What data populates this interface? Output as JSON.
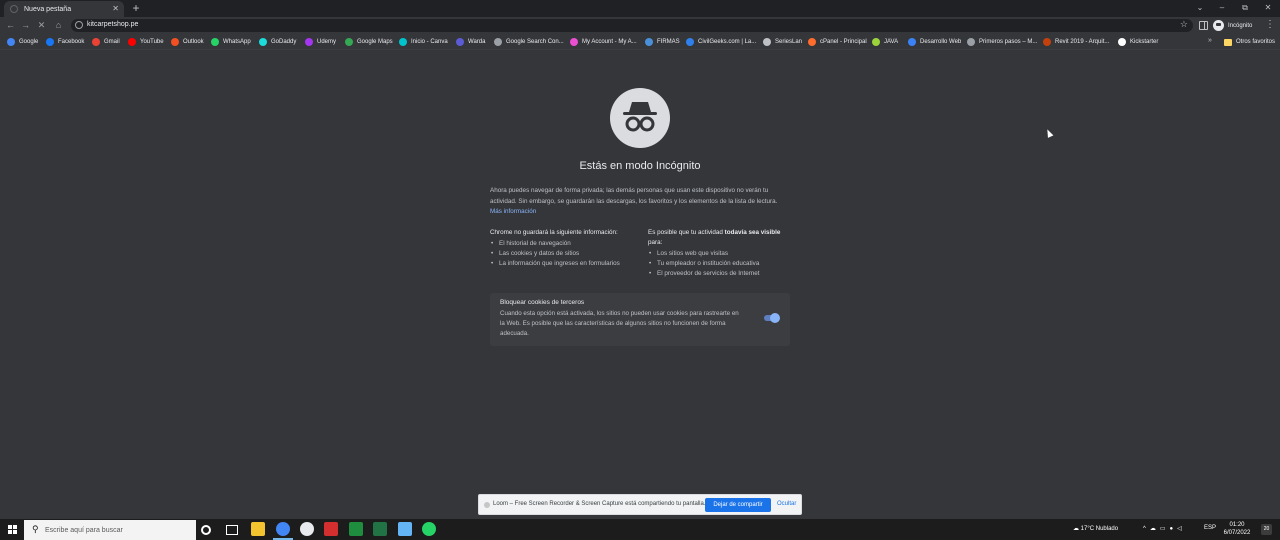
{
  "colors": {
    "page_bg": "#35363a",
    "tabstrip_bg": "#202124",
    "link": "#8ab4f8",
    "button_primary": "#1a73e8"
  },
  "tab": {
    "title": "Nueva pestaña",
    "close_icon": "close-icon",
    "new_tab_label": "+"
  },
  "window": {
    "minimize": "–",
    "restore": "⧉",
    "close": "✕",
    "tab_search": "⌄"
  },
  "toolbar": {
    "back": "←",
    "forward": "→",
    "reload": "✕",
    "home": "⌂",
    "url": "kitcarpetshop.pe",
    "star": "☆",
    "profile_label": "Incógnito",
    "menu": "⋮"
  },
  "bookmarks": {
    "items": [
      {
        "label": "Google",
        "icon": "google-icon",
        "color": "#4285f4"
      },
      {
        "label": "Facebook",
        "icon": "facebook-icon",
        "color": "#1877f2"
      },
      {
        "label": "Gmail",
        "icon": "gmail-icon",
        "color": "#ea4335"
      },
      {
        "label": "YouTube",
        "icon": "youtube-icon",
        "color": "#ff0000"
      },
      {
        "label": "Outlook",
        "icon": "outlook-icon",
        "color": "#f25022"
      },
      {
        "label": "WhatsApp",
        "icon": "whatsapp-icon",
        "color": "#25d366"
      },
      {
        "label": "GoDaddy",
        "icon": "godaddy-icon",
        "color": "#1bdbdb"
      },
      {
        "label": "Udemy",
        "icon": "udemy-icon",
        "color": "#a435f0"
      },
      {
        "label": "Google Maps",
        "icon": "maps-icon",
        "color": "#34a853"
      },
      {
        "label": "Inicio - Canva",
        "icon": "canva-icon",
        "color": "#00c4cc"
      },
      {
        "label": "Warda",
        "icon": "warda-icon",
        "color": "#5b5bd6"
      },
      {
        "label": "Google Search Con...",
        "icon": "search-console-icon",
        "color": "#9aa0a6"
      },
      {
        "label": "My Account - My A...",
        "icon": "account-icon",
        "color": "#e94fd0"
      },
      {
        "label": "FIRMAS",
        "icon": "firmas-icon",
        "color": "#4a90d9"
      },
      {
        "label": "CivilGeeks.com | La...",
        "icon": "civilgeeks-icon",
        "color": "#2f80ed"
      },
      {
        "label": "SeriesLan",
        "icon": "serieslan-icon",
        "color": "#bdc1c6"
      },
      {
        "label": "cPanel - Principal",
        "icon": "cpanel-icon",
        "color": "#ff6c2c"
      },
      {
        "label": "JAVA",
        "icon": "java-icon",
        "color": "#9bd33b"
      },
      {
        "label": "Desarrollo Web",
        "icon": "web-icon",
        "color": "#3b82f6"
      },
      {
        "label": "Primeros pasos – M...",
        "icon": "globe-icon",
        "color": "#9aa0a6"
      },
      {
        "label": "Revit 2019 - Arquit...",
        "icon": "revit-icon",
        "color": "#c2410c"
      },
      {
        "label": "Kickstarter",
        "icon": "kickstarter-icon",
        "color": "#ffffff"
      }
    ],
    "more": "»",
    "other_folder": "Otros favoritos"
  },
  "incognito": {
    "headline": "Estás en modo Incógnito",
    "intro": "Ahora puedes navegar de forma privada; las demás personas que usan este dispositivo no verán tu actividad. Sin embargo, se guardarán las descargas, los favoritos y los elementos de la lista de lectura.",
    "learn_more": "Más información",
    "left_heading": "Chrome no guardará la siguiente información:",
    "left_items": [
      "El historial de navegación",
      "Las cookies y datos de sitios",
      "La información que ingreses en formularios"
    ],
    "right_heading_pre": "Es posible que tu actividad ",
    "right_heading_bold": "todavía sea visible",
    "right_heading_post": " para:",
    "right_items": [
      "Los sitios web que visitas",
      "Tu empleador o institución educativa",
      "El proveedor de servicios de Internet"
    ],
    "cookie_title": "Bloquear cookies de terceros",
    "cookie_desc": "Cuando esta opción está activada, los sitios no pueden usar cookies para rastrearte en la Web. Es posible que las características de algunos sitios no funcionen de forma adecuada.",
    "cookie_toggle_on": true
  },
  "share_bar": {
    "text": "Loom – Free Screen Recorder & Screen Capture está compartiendo tu pantalla.",
    "stop_label": "Dejar de compartir",
    "hide_label": "Ocultar"
  },
  "taskbar": {
    "search_placeholder": "Escribe aquí para buscar",
    "weather": "17°C  Nublado",
    "language": "ESP",
    "time": "01:20",
    "date": "6/07/2022",
    "notification_count": "20"
  }
}
